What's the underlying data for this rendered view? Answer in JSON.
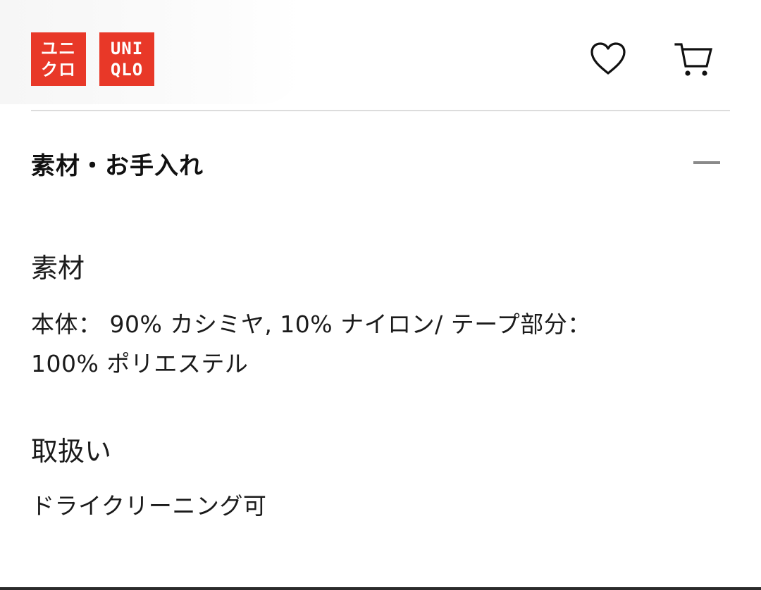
{
  "header": {
    "logo_ja": [
      "ユニ",
      "クロ"
    ],
    "logo_en": [
      "UNI",
      "QLO"
    ],
    "brand_color": "#e83828",
    "icons": [
      "heart-icon",
      "cart-icon"
    ]
  },
  "section": {
    "title": "素材・お手入れ",
    "toggle_icon": "minus-icon"
  },
  "material": {
    "heading": "素材",
    "line1": "本体： 90% カシミヤ,  10% ナイロン/ テープ部分：",
    "line2": "100% ポリエステル"
  },
  "care": {
    "heading": "取扱い",
    "text": "ドライクリーニング可"
  }
}
